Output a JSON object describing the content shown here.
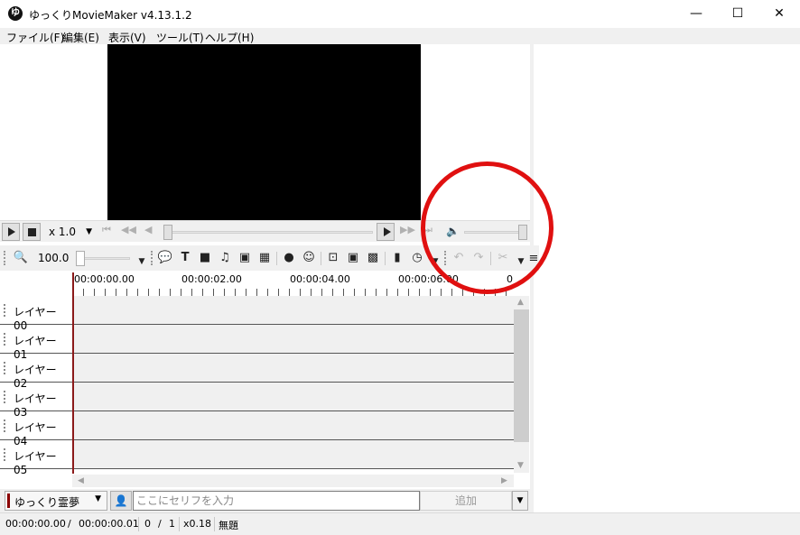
{
  "window": {
    "logo": "ゆ",
    "title": "ゆっくりMovieMaker v4.13.1.2",
    "minimize": "—",
    "maximize": "☐",
    "close": "✕"
  },
  "menu": [
    {
      "label": "ファイル(F)"
    },
    {
      "label": "編集(E)"
    },
    {
      "label": "表示(V)"
    },
    {
      "label": "ツール(T)"
    },
    {
      "label": "ヘルプ(H)"
    }
  ],
  "playback": {
    "speed": "x 1.0",
    "seek_position": 0,
    "volume": 1.0
  },
  "toolbar": {
    "zoom": "100.0"
  },
  "timeline": {
    "ruler_labels": [
      "00:00:00.00",
      "00:00:02.00",
      "00:00:04.00",
      "00:00:06.00",
      "0"
    ],
    "layers": [
      "レイヤー 00",
      "レイヤー 01",
      "レイヤー 02",
      "レイヤー 03",
      "レイヤー 04",
      "レイヤー 05"
    ]
  },
  "input": {
    "character": "ゆっくり霊夢",
    "character_color": "#8b0000",
    "placeholder": "ここにセリフを入力",
    "add_label": "追加"
  },
  "status": {
    "current_time": "00:00:00.00",
    "slash": "/",
    "total_time": "00:00:00.01",
    "frame": "0",
    "frame_sep": "/",
    "frame_total": "1",
    "speed": "x0.18",
    "project": "無題"
  },
  "colors": {
    "annotation": "#e01010",
    "playhead": "#8b1a1a"
  }
}
